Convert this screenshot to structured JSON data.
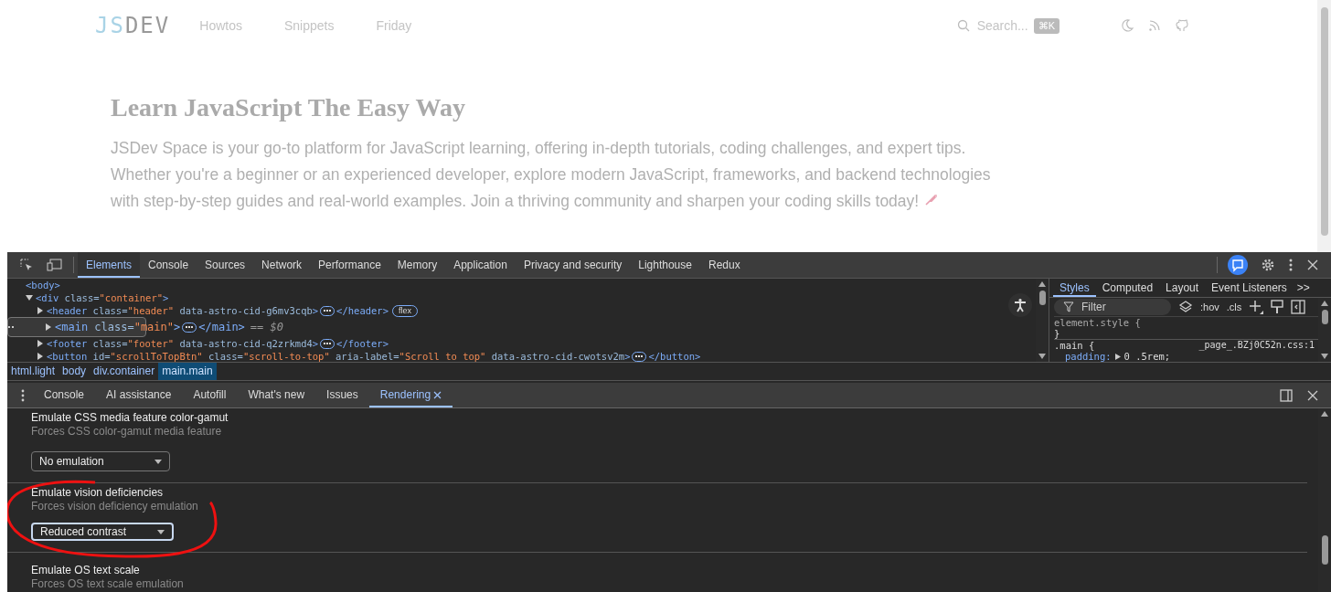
{
  "site": {
    "logo_left": "JS",
    "logo_right": "DEV",
    "nav": [
      "Howtos",
      "Snippets",
      "Friday"
    ],
    "search": {
      "placeholder": "Search...",
      "shortcut": "⌘K"
    },
    "title": "Learn JavaScript The Easy Way",
    "intro": "JSDev Space is your go-to platform for JavaScript learning, offering in-depth tutorials, coding challenges, and expert tips. Whether you're a beginner or an experienced developer, explore modern JavaScript, frameworks, and backend technologies with step-by-step guides and real-world examples. Join a thriving community and sharpen your coding skills today!"
  },
  "devtools": {
    "tabs": [
      {
        "label": "Elements",
        "selected": true
      },
      {
        "label": "Console",
        "selected": false
      },
      {
        "label": "Sources",
        "selected": false
      },
      {
        "label": "Network",
        "selected": false
      },
      {
        "label": "Performance",
        "selected": false
      },
      {
        "label": "Memory",
        "selected": false
      },
      {
        "label": "Application",
        "selected": false
      },
      {
        "label": "Privacy and security",
        "selected": false
      },
      {
        "label": "Lighthouse",
        "selected": false
      },
      {
        "label": "Redux",
        "selected": false
      }
    ],
    "dom": [
      {
        "tag": "<body>",
        "selected": false,
        "children": [
          {
            "expanded": true,
            "tag": "<div",
            "attrs": [
              {
                "n": "class=",
                "v": "\"container\""
              }
            ],
            "tail": ">",
            "selected": false,
            "children": [
              {
                "expanded": false,
                "tag": "<header",
                "attrs": [
                  {
                    "n": "class=",
                    "v": "\"header\""
                  },
                  {
                    "n": "data-astro-cid-g6mv3cqb"
                  }
                ],
                "tail": ">",
                "close": "</header>",
                "badge": "flex",
                "selected": false
              },
              {
                "expanded": false,
                "tag": "<main",
                "attrs": [
                  {
                    "n": "class=",
                    "v": "\"main\""
                  }
                ],
                "tail": ">",
                "close": "</main>",
                "suffix": "== $0",
                "selected": true
              },
              {
                "expanded": false,
                "tag": "<footer",
                "attrs": [
                  {
                    "n": "class=",
                    "v": "\"footer\""
                  },
                  {
                    "n": "data-astro-cid-q2zrkmd4"
                  }
                ],
                "tail": ">",
                "close": "</footer>",
                "selected": false
              },
              {
                "expanded": false,
                "tag": "<button",
                "attrs": [
                  {
                    "n": "id=",
                    "v": "\"scrollToTopBtn\""
                  },
                  {
                    "n": "class=",
                    "v": "\"scroll-to-top\""
                  },
                  {
                    "n": "aria-label=",
                    "v": "\"Scroll to top\""
                  },
                  {
                    "n": "data-astro-cid-cwotsv2m"
                  }
                ],
                "tail": ">",
                "close": "</button>",
                "selected": false
              }
            ]
          }
        ]
      }
    ],
    "breadcrumbs": [
      {
        "label": "html.light",
        "selected": false
      },
      {
        "label": "body",
        "selected": false
      },
      {
        "label": "div.container",
        "selected": false
      },
      {
        "label": "main.main",
        "selected": true
      }
    ],
    "side_tabs": [
      {
        "label": "Styles",
        "selected": true
      },
      {
        "label": "Computed",
        "selected": false
      },
      {
        "label": "Layout",
        "selected": false
      },
      {
        "label": "Event Listeners",
        "selected": false
      }
    ],
    "side_more": ">>",
    "filter": {
      "placeholder": "Filter"
    },
    "hov": ":hov",
    "cls": ".cls",
    "styles": {
      "element_selector": "element.style",
      "open": "{",
      "close": "}",
      "rule_selector": ".main",
      "rule_open": "{",
      "source": "_page_.BZj0C52n.css:1",
      "prop": "padding:",
      "value": "0 .5rem;"
    },
    "drawer_tabs": [
      {
        "label": "Console",
        "selected": false,
        "closable": false
      },
      {
        "label": "AI assistance",
        "selected": false,
        "closable": false
      },
      {
        "label": "Autofill",
        "selected": false,
        "closable": false
      },
      {
        "label": "What's new",
        "selected": false,
        "closable": false
      },
      {
        "label": "Issues",
        "selected": false,
        "closable": false
      },
      {
        "label": "Rendering",
        "selected": true,
        "closable": true
      }
    ],
    "sections": [
      {
        "title": "Emulate CSS media feature color-gamut",
        "desc": "Forces CSS color-gamut media feature",
        "select": "No emulation",
        "focused": false,
        "circled": false
      },
      {
        "title": "Emulate vision deficiencies",
        "desc": "Forces vision deficiency emulation",
        "select": "Reduced contrast",
        "focused": true,
        "circled": true
      },
      {
        "title": "Emulate OS text scale",
        "desc": "Forces OS text scale emulation"
      }
    ]
  }
}
